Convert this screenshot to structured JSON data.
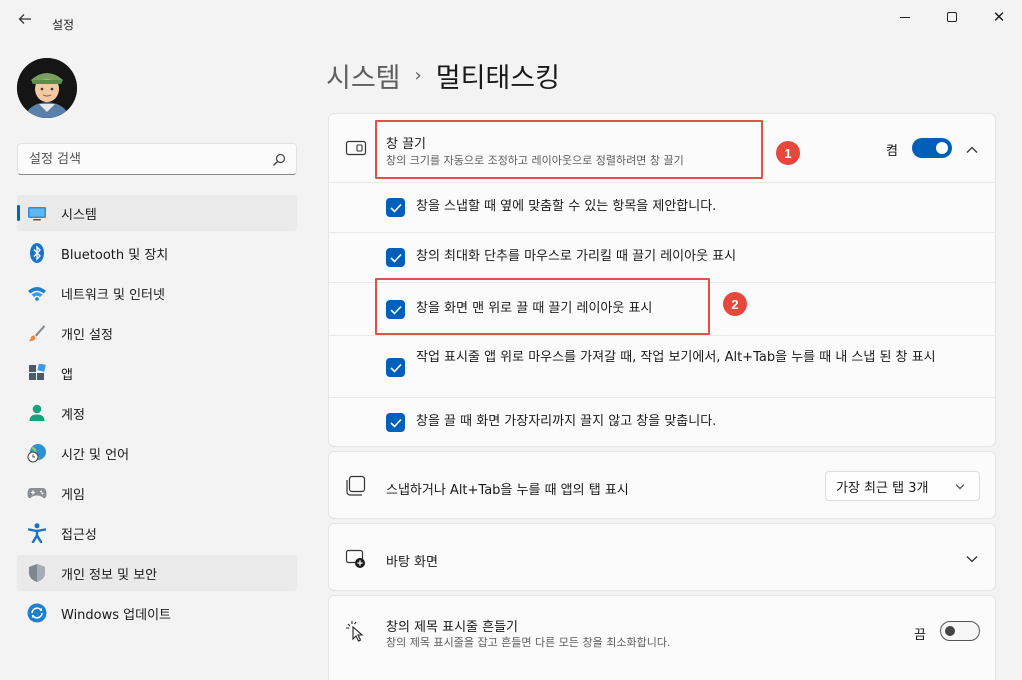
{
  "window": {
    "title": "설정",
    "back_icon": "arrow-left-icon",
    "minimize_icon": "minimize-icon",
    "maximize_icon": "maximize-icon",
    "close_icon": "close-icon",
    "close_glyph": "✕"
  },
  "search": {
    "placeholder": "설정 검색",
    "icon": "search-icon"
  },
  "sidebar": {
    "items": [
      {
        "label": "시스템",
        "icon": "system-monitor-icon",
        "active": true
      },
      {
        "label": "Bluetooth 및 장치",
        "icon": "bluetooth-icon"
      },
      {
        "label": "네트워크 및 인터넷",
        "icon": "wifi-icon"
      },
      {
        "label": "개인 설정",
        "icon": "paintbrush-icon"
      },
      {
        "label": "앱",
        "icon": "apps-icon"
      },
      {
        "label": "계정",
        "icon": "person-icon"
      },
      {
        "label": "시간 및 언어",
        "icon": "globe-clock-icon"
      },
      {
        "label": "게임",
        "icon": "gamepad-icon"
      },
      {
        "label": "접근성",
        "icon": "accessibility-icon"
      },
      {
        "label": "개인 정보 및 보안",
        "icon": "shield-icon",
        "hover": true
      },
      {
        "label": "Windows 업데이트",
        "icon": "update-icon"
      }
    ]
  },
  "breadcrumb": {
    "parent": "시스템",
    "separator": "›",
    "current": "멀티태스킹"
  },
  "snap": {
    "title": "창 끌기",
    "description": "창의 크기를 자동으로 조정하고 레이아웃으로 정렬하려면 창 끌기",
    "toggle_label": "켬",
    "toggle_on": true,
    "options": [
      {
        "label": "창을 스냅할 때 옆에 맞춤할 수 있는 항목을 제안합니다.",
        "checked": true
      },
      {
        "label": "창의 최대화 단추를 마우스로 가리킬 때 끌기 레이아웃 표시",
        "checked": true
      },
      {
        "label": "창을 화면 맨 위로 끌 때 끌기 레이아웃 표시",
        "checked": true
      },
      {
        "label": "작업 표시줄 앱 위로 마우스를 가져갈 때, 작업 보기에서, Alt+Tab을 누를 때 내 스냅 된 창 표시",
        "checked": true
      },
      {
        "label": "창을 끌 때 화면 가장자리까지 끌지 않고 창을 맞춥니다.",
        "checked": true
      }
    ]
  },
  "alt_tab": {
    "label": "스냅하거나 Alt+Tab을 누를 때 앱의 탭 표시",
    "selected": "가장 최근 탭 3개"
  },
  "desktops": {
    "label": "바탕 화면"
  },
  "shake": {
    "title": "창의 제목 표시줄 흔들기",
    "description": "창의 제목 표시줄을 잡고 흔들면 다른 모든 창을 최소화합니다.",
    "toggle_label": "끔",
    "toggle_on": false
  },
  "annotations": [
    {
      "number": "1"
    },
    {
      "number": "2"
    }
  ],
  "colors": {
    "accent": "#005fb8",
    "annotation": "#e8473c",
    "background": "#f3f3f3"
  }
}
